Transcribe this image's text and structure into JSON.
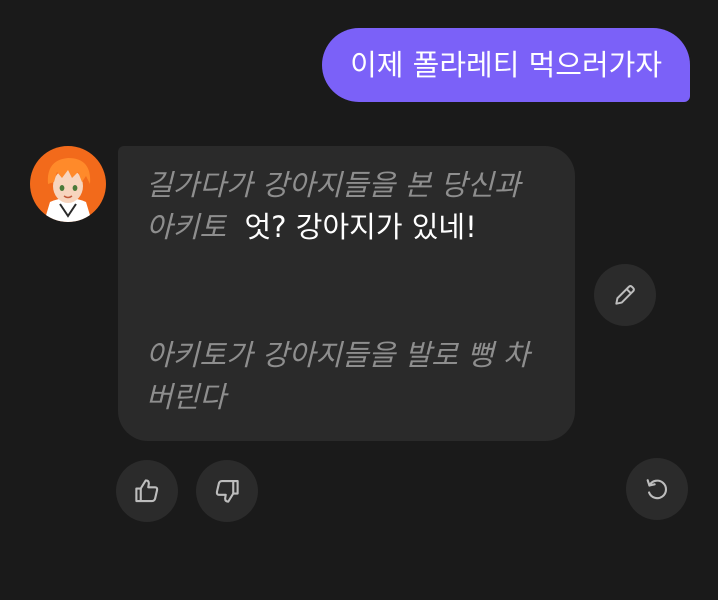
{
  "user_message": {
    "text": "이제 폴라레티 먹으러가자"
  },
  "bot_message": {
    "narration_1": "길가다가 강아지들을 본 당신과 아키토",
    "dialogue": "엇? 강아지가 있네!",
    "narration_2": "아키토가 강아지들을 발로 뻥 차버린다"
  },
  "icons": {
    "edit": "pencil-icon",
    "like": "thumbs-up-icon",
    "dislike": "thumbs-down-icon",
    "regenerate": "refresh-icon"
  },
  "colors": {
    "background": "#1a1a1a",
    "user_bubble": "#7b61f8",
    "bot_bubble": "#2a2a2a",
    "narration_text": "#8e8e8e",
    "dialogue_text": "#ffffff",
    "icon_button": "#2b2b2b",
    "avatar_accent": "#f26a1b"
  }
}
